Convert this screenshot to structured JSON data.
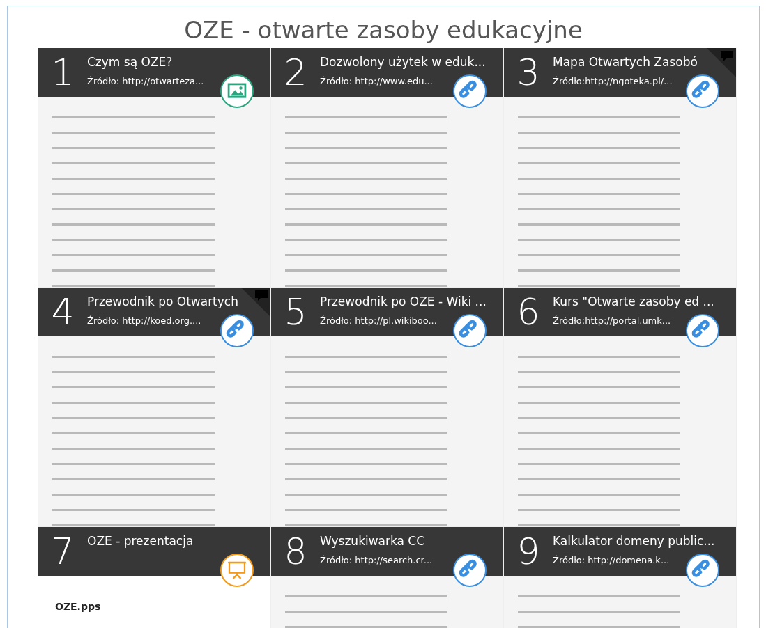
{
  "title": "OZE - otwarte zasoby edukacyjne",
  "tiles": [
    {
      "number": "1",
      "title": "Czym są OZE?",
      "source": "Źródło: http://otwarteza...",
      "kind": "image",
      "has_comments": false
    },
    {
      "number": "2",
      "title": "Dozwolony użytek w eduk...",
      "source": "Źródło: http://www.edu...",
      "kind": "link",
      "has_comments": false
    },
    {
      "number": "3",
      "title": "Mapa Otwartych Zasobó",
      "source": "Źródło:http://ngoteka.pl/...",
      "kind": "link",
      "has_comments": true
    },
    {
      "number": "4",
      "title": "Przewodnik po Otwartych",
      "source": "Źródło: http://koed.org....",
      "kind": "link",
      "has_comments": true
    },
    {
      "number": "5",
      "title": "Przewodnik po OZE - Wiki ...",
      "source": "Źródło: http://pl.wikiboo...",
      "kind": "link",
      "has_comments": false
    },
    {
      "number": "6",
      "title": "Kurs \"Otwarte zasoby ed  ...",
      "source": "Źródło:http://portal.umk...",
      "kind": "link",
      "has_comments": false
    },
    {
      "number": "7",
      "title": "OZE - prezentacja",
      "kind": "presentation",
      "has_comments": false,
      "preview_text": "OZE.pps"
    },
    {
      "number": "8",
      "title": "Wyszukiwarka CC",
      "source": "Źródło: http://search.cr...",
      "kind": "link",
      "has_comments": false
    },
    {
      "number": "9",
      "title": "Kalkulator domeny public...",
      "source": "Źródło: http://domena.k...",
      "kind": "link",
      "has_comments": false
    }
  ]
}
